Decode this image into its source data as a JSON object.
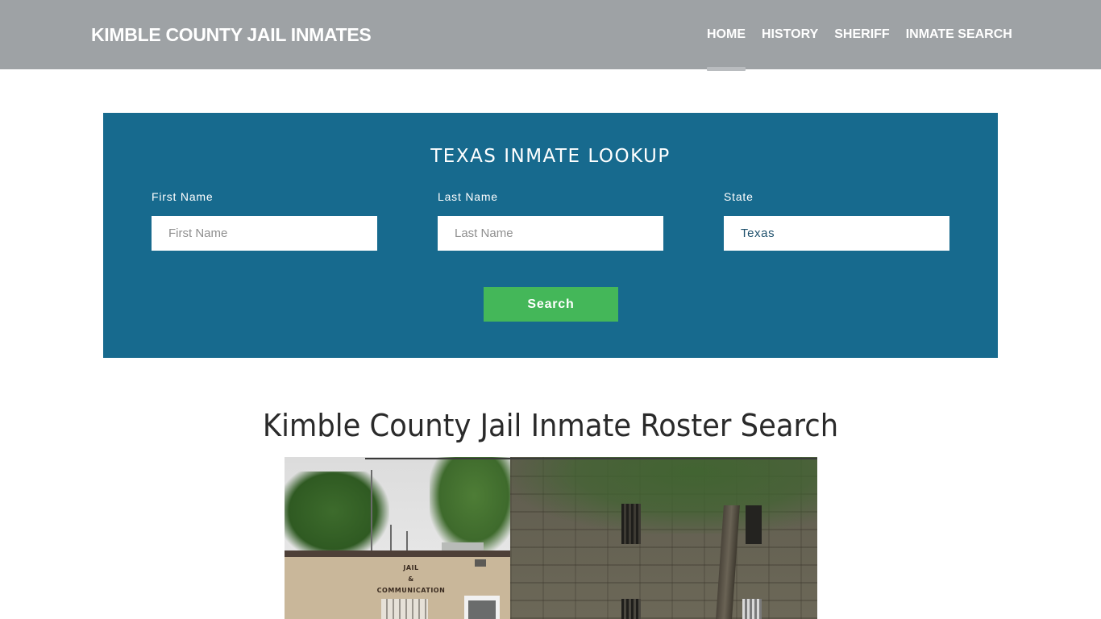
{
  "header": {
    "brand": "KIMBLE COUNTY JAIL INMATES",
    "nav": [
      {
        "label": "HOME",
        "active": true
      },
      {
        "label": "HISTORY",
        "active": false
      },
      {
        "label": "SHERIFF",
        "active": false
      },
      {
        "label": "INMATE SEARCH",
        "active": false
      }
    ]
  },
  "lookup": {
    "title": "TEXAS INMATE LOOKUP",
    "fields": {
      "first_name": {
        "label": "First Name",
        "placeholder": "First Name",
        "value": ""
      },
      "last_name": {
        "label": "Last Name",
        "placeholder": "Last Name",
        "value": ""
      },
      "state": {
        "label": "State",
        "value": "Texas"
      }
    },
    "search_label": "Search"
  },
  "main": {
    "title": "Kimble County Jail Inmate Roster Search",
    "photo": {
      "description": "Kimble County jail building photo",
      "sign_lines": [
        "JAIL",
        "&",
        "COMMUNICATION"
      ]
    }
  },
  "colors": {
    "header_bg": "#9ea2a5",
    "panel_bg": "#176a8e",
    "button_bg": "#44b759"
  }
}
